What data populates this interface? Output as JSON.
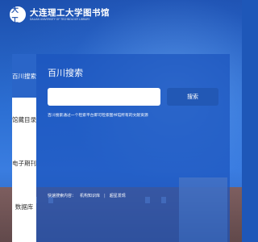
{
  "header": {
    "logo_emblem": "大工",
    "logo_cn": "大连理工大学图书馆",
    "logo_en": "DALIAN UNIVERSITY OF TECHNOLOGY LIBRARY"
  },
  "tabs": [
    {
      "label": "百川搜索",
      "active": true
    },
    {
      "label": "馆藏目录",
      "active": false
    },
    {
      "label": "电子期刊",
      "active": false
    },
    {
      "label": "数据库",
      "active": false
    }
  ],
  "search": {
    "title": "百川搜索",
    "input_value": "",
    "placeholder": "",
    "button_label": "搜索",
    "description": "百川搜索通过一个检索平台即可检索图书馆所有的文献资源"
  },
  "quick_search": {
    "label": "快速搜索内容：",
    "links": [
      "机构知识库",
      "超星发现"
    ]
  },
  "colors": {
    "active_tab": "#2a65c8",
    "panel_bg": "#1c54be",
    "button": "#2258b5"
  }
}
